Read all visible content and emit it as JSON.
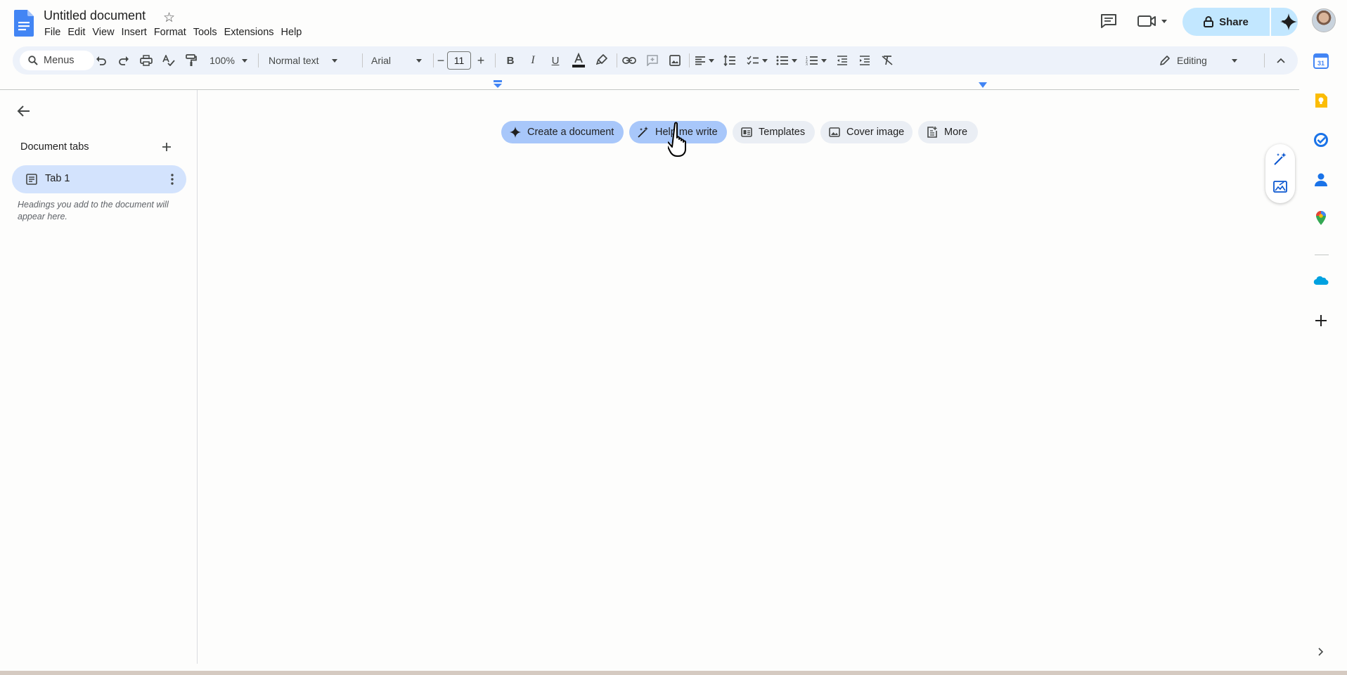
{
  "header": {
    "title": "Untitled document",
    "menus": [
      "File",
      "Edit",
      "View",
      "Insert",
      "Format",
      "Tools",
      "Extensions",
      "Help"
    ],
    "share_label": "Share"
  },
  "toolbar": {
    "search_label": "Menus",
    "zoom": "100%",
    "style": "Normal text",
    "font": "Arial",
    "font_size": "11",
    "mode": "Editing"
  },
  "sidebar": {
    "title": "Document tabs",
    "tabs": [
      {
        "label": "Tab 1"
      }
    ],
    "hint": "Headings you add to the document will appear here."
  },
  "chips": [
    {
      "label": "Create a document",
      "icon": "sparkle-icon"
    },
    {
      "label": "Help me write",
      "icon": "pen-spark-icon"
    },
    {
      "label": "Templates",
      "icon": "template-icon"
    },
    {
      "label": "Cover image",
      "icon": "image-icon"
    },
    {
      "label": "More",
      "icon": "more-doc-icon"
    }
  ],
  "addons": [
    "calendar-icon",
    "keep-icon",
    "tasks-icon",
    "contacts-icon",
    "maps-icon",
    "salesforce-icon",
    "add-addon-icon"
  ],
  "colors": {
    "accent": "#0b57d0",
    "toolbar_bg": "#edf2fa",
    "chip_active": "#a8c7fa",
    "share_bg": "#c2e7ff",
    "tab_selected": "#d3e3fd"
  }
}
